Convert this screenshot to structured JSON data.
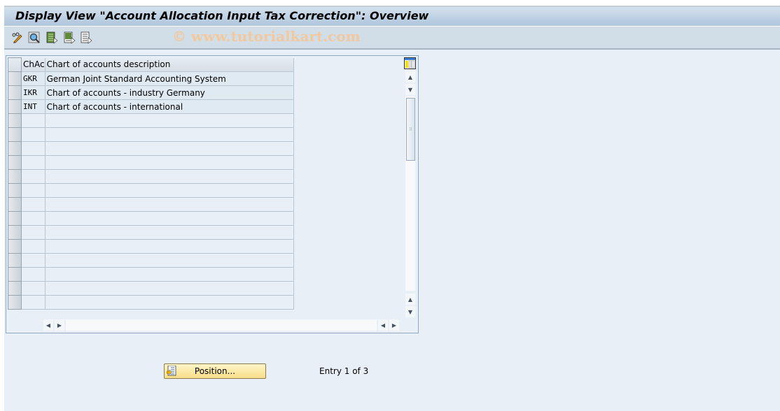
{
  "window": {
    "title": "Display View \"Account Allocation Input Tax Correction\": Overview",
    "watermark": "© www.tutorialkart.com"
  },
  "toolbar": {
    "buttons": [
      {
        "name": "display-change-icon",
        "tooltip": "Display -> Change"
      },
      {
        "name": "find-icon",
        "tooltip": "Find"
      },
      {
        "name": "select-all-icon",
        "tooltip": "Select All"
      },
      {
        "name": "select-block-icon",
        "tooltip": "Select Block"
      },
      {
        "name": "deselect-all-icon",
        "tooltip": "Deselect All"
      }
    ]
  },
  "table": {
    "columns": [
      "ChAc",
      "Chart of accounts description"
    ],
    "rows": [
      [
        "GKR",
        "German Joint Standard Accounting System"
      ],
      [
        "IKR",
        "Chart of accounts - industry Germany"
      ],
      [
        "INT",
        "Chart of accounts - international"
      ]
    ],
    "empty_rows": 14
  },
  "footer": {
    "position_button": "Position...",
    "entry_status": "Entry 1 of 3"
  }
}
